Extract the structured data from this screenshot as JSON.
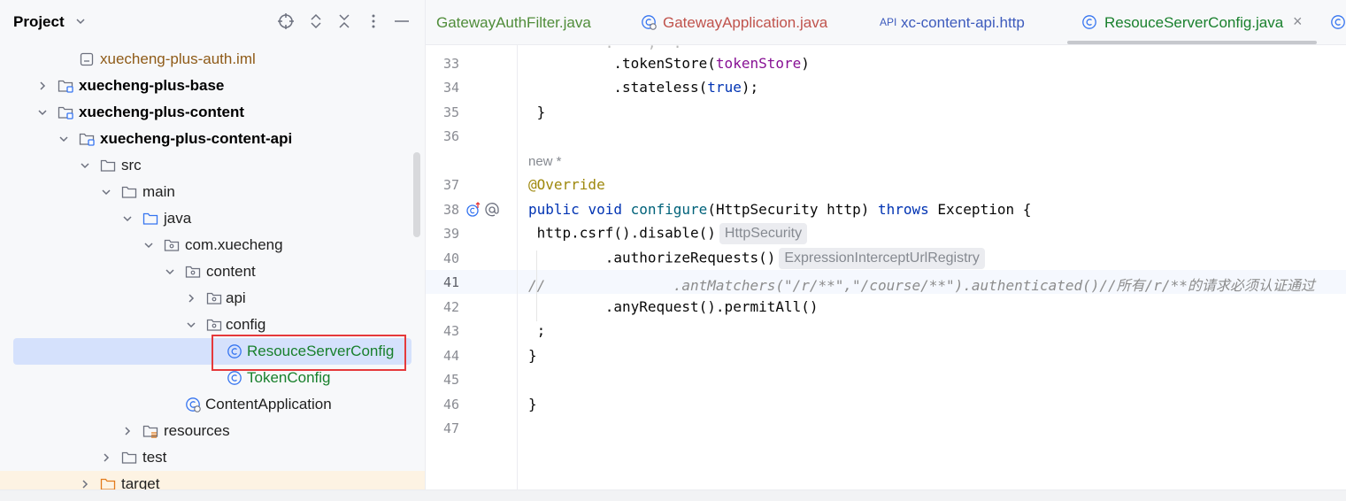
{
  "project_panel": {
    "title": "Project",
    "tree": [
      {
        "label": "xuecheng-plus-auth.iml",
        "kind": "iml"
      },
      {
        "label": "xuecheng-plus-base",
        "kind": "module",
        "expanded": false
      },
      {
        "label": "xuecheng-plus-content",
        "kind": "module",
        "expanded": true
      },
      {
        "label": "xuecheng-plus-content-api",
        "kind": "module",
        "expanded": true
      },
      {
        "label": "src",
        "kind": "folder",
        "expanded": true
      },
      {
        "label": "main",
        "kind": "folder",
        "expanded": true
      },
      {
        "label": "java",
        "kind": "source-folder",
        "expanded": true
      },
      {
        "label": "com.xuecheng",
        "kind": "package",
        "expanded": true
      },
      {
        "label": "content",
        "kind": "package",
        "expanded": true
      },
      {
        "label": "api",
        "kind": "package",
        "expanded": false
      },
      {
        "label": "config",
        "kind": "package",
        "expanded": true
      },
      {
        "label": "ResouceServerConfig",
        "kind": "class",
        "selected": true
      },
      {
        "label": "TokenConfig",
        "kind": "class"
      },
      {
        "label": "ContentApplication",
        "kind": "spring-class"
      },
      {
        "label": "resources",
        "kind": "resources-folder",
        "expanded": false
      },
      {
        "label": "test",
        "kind": "folder",
        "expanded": false
      },
      {
        "label": "target",
        "kind": "excluded-folder",
        "expanded": false
      }
    ]
  },
  "tabs": [
    {
      "label": "GatewayAuthFilter.java",
      "color": "#508d3a"
    },
    {
      "label": "GatewayApplication.java",
      "color": "#c0534c"
    },
    {
      "label": "xc-content-api.http",
      "prefix": "API",
      "color": "#3d5bbd"
    },
    {
      "label": "ResouceServerConfig.java",
      "color": "#19802d",
      "active": true,
      "close": "×"
    }
  ],
  "editor": {
    "lines": {
      "l33": "33",
      "l34": "34",
      "l35": "35",
      "l36": "36",
      "l37": "37",
      "l38": "38",
      "l39": "39",
      "l40": "40",
      "l41": "41",
      "l42": "42",
      "l43": "43",
      "l44": "44",
      "l45": "45",
      "l46": "46",
      "l47": "47"
    },
    "new_hint": "new *",
    "code": {
      "c33_a": ".tokenStore(",
      "c33_b": "tokenStore",
      "c33_c": ")",
      "c34_a": ".stateless(",
      "c34_b": "true",
      "c34_c": ");",
      "c35": " }",
      "c37": "@Override",
      "c38_a": "public",
      "c38_b": " ",
      "c38_c": "void",
      "c38_d": " ",
      "c38_e": "configure",
      "c38_f": "(HttpSecurity http) ",
      "c38_g": "throws",
      "c38_h": " Exception {",
      "c39": " http.csrf().disable()",
      "c39_hint": "HttpSecurity",
      "c40": "         .authorizeRequests()",
      "c40_hint": "ExpressionInterceptUrlRegistry",
      "c41": "//               .antMatchers(\"/r/**\",\"/course/**\").authenticated()//所有/r/**的请求必须认证通过",
      "c42": "         .anyRequest().permitAll()",
      "c43": " ;",
      "c44": "}",
      "c46": "}"
    }
  }
}
